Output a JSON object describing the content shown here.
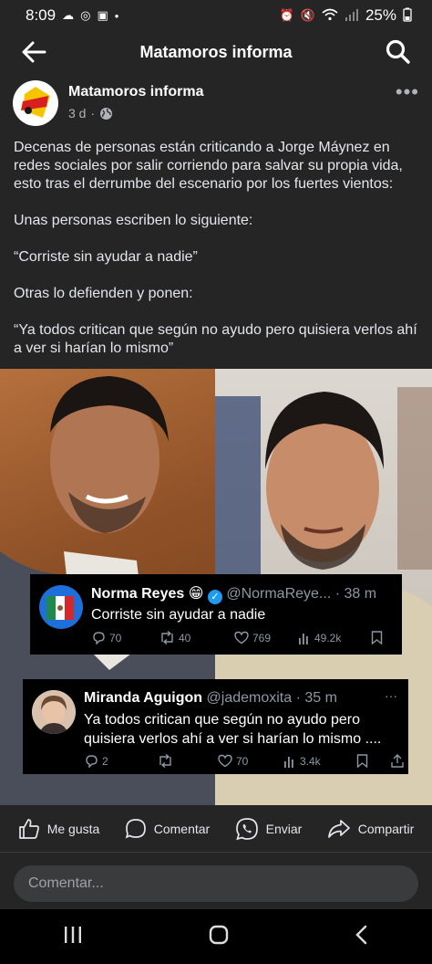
{
  "status_bar": {
    "time": "8:09",
    "battery": "25%"
  },
  "app_bar": {
    "title": "Matamoros informa"
  },
  "post": {
    "page_name": "Matamoros informa",
    "time": "3 d",
    "paragraphs": [
      "Decenas de personas están criticando a Jorge Máynez en redes sociales por salir corriendo para salvar su propia vida, esto tras el derrumbe del escenario por los fuertes vientos:",
      "Unas personas escriben lo siguiente:",
      "“Corriste sin ayudar a nadie”",
      "Otras lo defienden y ponen:",
      "“Ya todos critican que según no ayudo pero quisiera verlos ahí a ver si harían lo mismo”"
    ]
  },
  "tweets": [
    {
      "name": "Norma Reyes",
      "emoji": "😁",
      "handle": "@NormaReye...",
      "time": "38 m",
      "text": "Corriste sin ayudar a nadie",
      "replies": "70",
      "retweets": "40",
      "likes": "769",
      "views": "49.2k"
    },
    {
      "name": "Miranda Aguigon",
      "handle": "@jademoxita",
      "time": "35 m",
      "text": "Ya todos critican que según no ayudo pero quisiera verlos ahí a ver si harían lo mismo ....",
      "replies": "2",
      "likes": "70",
      "views": "3.4k"
    }
  ],
  "actions": {
    "like": "Me gusta",
    "comment": "Comentar",
    "send": "Enviar",
    "share": "Compartir"
  },
  "comment_input": {
    "placeholder": "Comentar..."
  },
  "colors": {
    "background": "#252526",
    "tweet_background": "#000000",
    "verified": "#1d9bf0"
  }
}
